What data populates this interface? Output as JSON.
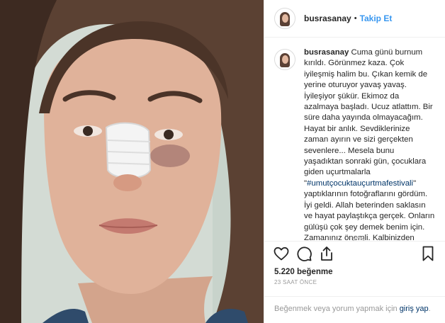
{
  "post": {
    "username": "busrasanay",
    "separator": "•",
    "follow_label": "Takip Et",
    "caption": {
      "username": "busrasanay",
      "text_before_hashtag": " Cuma günü burnum kırıldı. Görünmez kaza. Çok iyileşmiş halim bu. Çıkan kemik de yerine oturuyor yavaş yavaş. İyileşiyor şükür. Ekimoz da azalmaya başladı. Ucuz atlattım. Bir süre daha yayında olmayacağım. Hayat bir anlık. Sevdiklerinize zaman ayırın ve sizi gerçekten sevenlere... Mesela bunu yaşadıktan sonraki gün, çocuklara giden uçurtmalarla \"",
      "hashtag": "#umutçocuktauçurtmafestivali",
      "text_after_hashtag": "\" yaptıklarının fotoğraflarını gördüm. İyi geldi. Allah beterinden saklasın ve hayat paylaştıkça gerçek. Onların gülüşü çok şey demek benim için. Zamanınız önemli. Kalbinizden geçtiği gibi harcayın."
    },
    "caption_age": "23s",
    "likes": "5.220 beğenme",
    "posted_ago": "23 SAAT ÖNCE",
    "login_prompt_before": "Beğenmek veya yorum yapmak için ",
    "login_link": "giriş yap",
    "login_prompt_after": ".",
    "icons": {
      "like": "heart-icon",
      "comment": "comment-bubble-icon",
      "share": "share-icon",
      "save": "bookmark-icon",
      "loading": "loading-spinner-icon"
    },
    "colors": {
      "link": "#3897f0",
      "hashtag": "#003569",
      "border": "#efefef",
      "muted": "#999999"
    }
  }
}
